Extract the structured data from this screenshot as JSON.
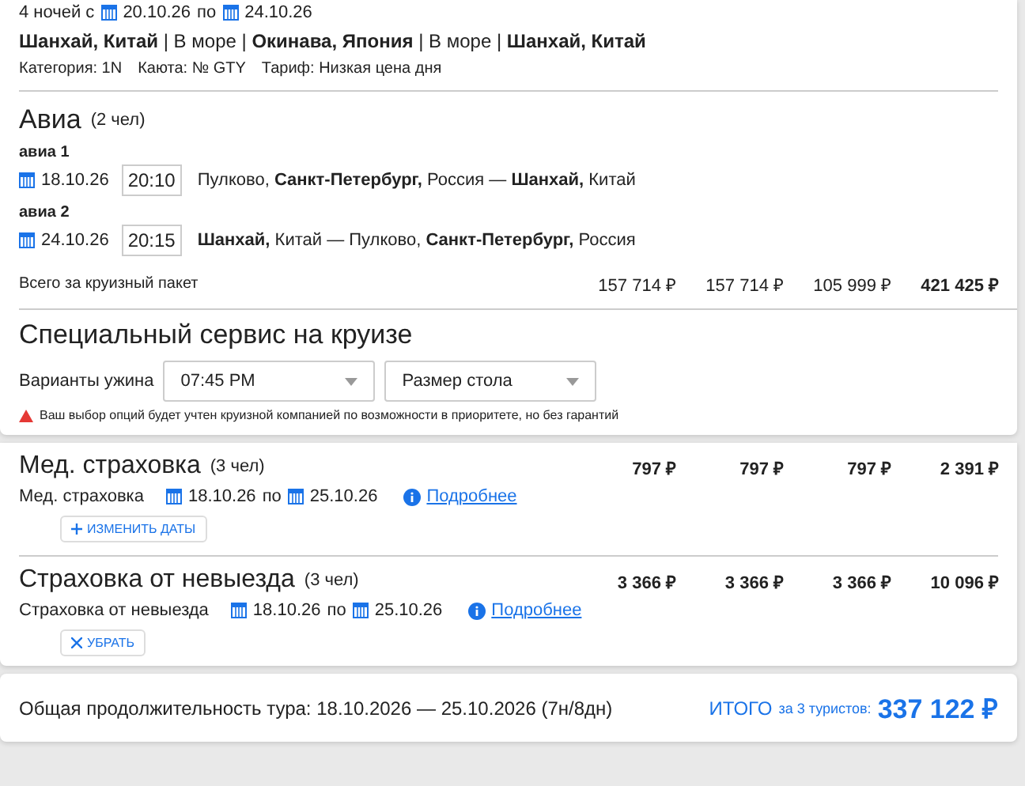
{
  "cruise": {
    "nights": "4 ночей с",
    "date_from": "20.10.26",
    "by": "по",
    "date_to": "24.10.26",
    "route": "**Шанхай, Китай** | В море | **Окинава, Япония** | В море | **Шанхай, Китай**",
    "details": [
      "Категория: 1N",
      "Каюта: № GTY",
      "Тариф: Низкая цена дня"
    ]
  },
  "avia": {
    "title": "Авиа",
    "count": "(2 чел)",
    "flights": [
      {
        "label": "авиа 1",
        "date": "18.10.26",
        "time": "20:10",
        "route": "Пулково, **Санкт-Петербург,** Россия — **Шанхай,** Китай"
      },
      {
        "label": "авиа 2",
        "date": "24.10.26",
        "time": "20:15",
        "route": "**Шанхай,** Китай — Пулково, **Санкт-Петербург,** Россия"
      }
    ],
    "total_label": "Всего за круизный пакет",
    "prices": [
      "157 714 ₽",
      "157 714 ₽",
      "105 999 ₽",
      "421 425 ₽"
    ]
  },
  "service": {
    "title": "Специальный сервис на круизе",
    "label": "Варианты ужина",
    "selects": [
      {
        "value": "07:45 PM"
      },
      {
        "placeholder": "Размер стола"
      }
    ],
    "warning": "Ваш выбор опций будет учтен круизной компанией по возможности в приоритете, но без гарантий"
  },
  "insurances": [
    {
      "title": "Мед. страховка",
      "count": "(3 чел)",
      "prices": [
        "797 ₽",
        "797 ₽",
        "797 ₽",
        "2 391 ₽"
      ],
      "name": "Мед. страховка",
      "date_from": "18.10.26",
      "by": "по",
      "date_to": "25.10.26",
      "link": "Подробнее",
      "action": {
        "kind": "add",
        "label": "ИЗМЕНИТЬ ДАТЫ"
      }
    },
    {
      "title": "Страховка от невыезда",
      "count": "(3 чел)",
      "prices": [
        "3 366 ₽",
        "3 366 ₽",
        "3 366 ₽",
        "10 096 ₽"
      ],
      "name": "Страховка от невыезда",
      "date_from": "18.10.26",
      "by": "по",
      "date_to": "25.10.26",
      "link": "Подробнее",
      "action": {
        "kind": "remove",
        "label": "УБРАТЬ"
      }
    }
  ],
  "footer": {
    "duration": "Общая продолжительность тура: 18.10.2026 — 25.10.2026 (7н/8дн)",
    "total_label": "ИТОГО",
    "total_sub": "за 3 туристов:",
    "total": "337 122 ₽"
  }
}
